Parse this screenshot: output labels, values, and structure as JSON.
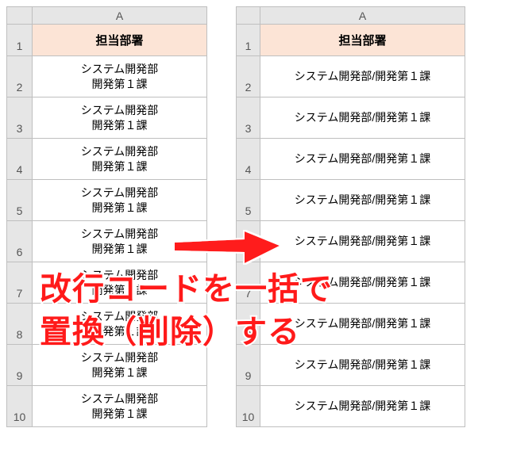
{
  "left_table": {
    "col_letter": "A",
    "header": "担当部署",
    "row_numbers": [
      "1",
      "2",
      "3",
      "4",
      "5",
      "6",
      "7",
      "8",
      "9",
      "10"
    ],
    "rows": [
      "システム開発部\n開発第１課",
      "システム開発部\n開発第１課",
      "システム開発部\n開発第１課",
      "システム開発部\n開発第１課",
      "システム開発部\n開発第１課",
      "システム開発部\n開発第１課",
      "システム開発部\n開発第１課",
      "システム開発部\n開発第１課",
      "システム開発部\n開発第１課"
    ]
  },
  "right_table": {
    "col_letter": "A",
    "header": "担当部署",
    "row_numbers": [
      "1",
      "2",
      "3",
      "4",
      "5",
      "6",
      "7",
      "8",
      "9",
      "10"
    ],
    "rows": [
      "システム開発部/開発第１課",
      "システム開発部/開発第１課",
      "システム開発部/開発第１課",
      "システム開発部/開発第１課",
      "システム開発部/開発第１課",
      "システム開発部/開発第１課",
      "システム開発部/開発第１課",
      "システム開発部/開発第１課",
      "システム開発部/開発第１課"
    ]
  },
  "overlay_caption": "改行コードを一括で\n置換（削除）する"
}
